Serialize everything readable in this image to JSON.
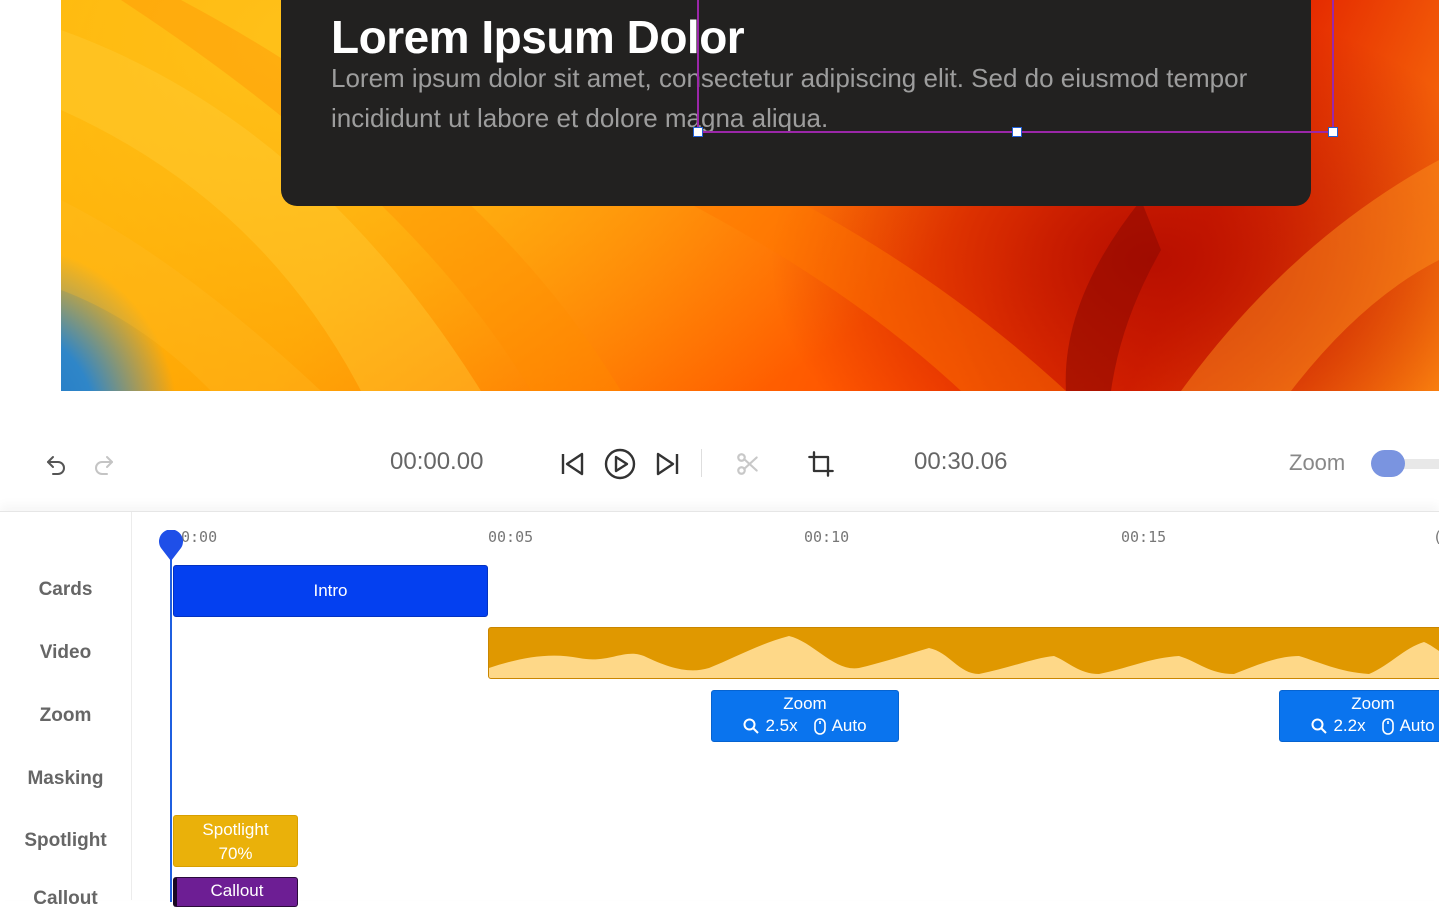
{
  "preview": {
    "card_title": "Lorem Ipsum Dolor",
    "card_body": "Lorem ipsum dolor sit amet, consectetur adipiscing elit. Sed do eiusmod tempor incididunt ut labore et dolore magna aliqua."
  },
  "controls": {
    "undo_icon": "undo-icon",
    "redo_icon": "redo-icon",
    "current_time": "00:00.00",
    "total_time": "00:30.06",
    "zoom_label": "Zoom",
    "accent_color": "#1f5fe0"
  },
  "timeline": {
    "ticks": [
      "0:00",
      "00:05",
      "00:10",
      "00:15"
    ],
    "tracks": [
      "Cards",
      "Video",
      "Zoom",
      "Masking",
      "Spotlight",
      "Callout"
    ],
    "clips": {
      "intro": "Intro",
      "zoom1": {
        "title": "Zoom",
        "level": "2.5x",
        "mode": "Auto"
      },
      "zoom2": {
        "title": "Zoom",
        "level": "2.2x",
        "mode": "Auto"
      },
      "spotlight": {
        "title": "Spotlight",
        "amount": "70%"
      },
      "callout": "Callout"
    },
    "colors": {
      "cards": "#0440f0",
      "video": "#e09800",
      "zoom": "#0a74ee",
      "spotlight": "#eab10a",
      "callout": "#6d1e94"
    }
  }
}
